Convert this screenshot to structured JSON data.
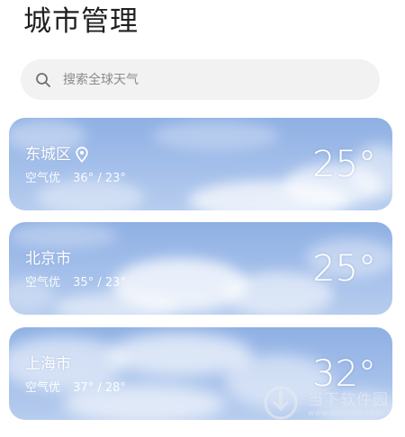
{
  "header": {
    "title": "城市管理"
  },
  "search": {
    "placeholder": "搜索全球天气"
  },
  "cities": [
    {
      "name": "东城区",
      "is_current_location": true,
      "air_quality": "空气优",
      "temp_range": "36° / 23°",
      "temperature": "25°"
    },
    {
      "name": "北京市",
      "is_current_location": false,
      "air_quality": "空气优",
      "temp_range": "35° / 23°",
      "temperature": "25°"
    },
    {
      "name": "上海市",
      "is_current_location": false,
      "air_quality": "空气优",
      "temp_range": "37° / 28°",
      "temperature": "32°"
    }
  ],
  "watermark": {
    "text": "当下软件园",
    "url": "www.downxia.com"
  },
  "colors": {
    "card_sky": "#9bb8e8",
    "search_bg": "#f2f2f2",
    "title": "#1f1f1f"
  },
  "icons": {
    "search": "search-icon",
    "location": "location-pin-icon"
  }
}
